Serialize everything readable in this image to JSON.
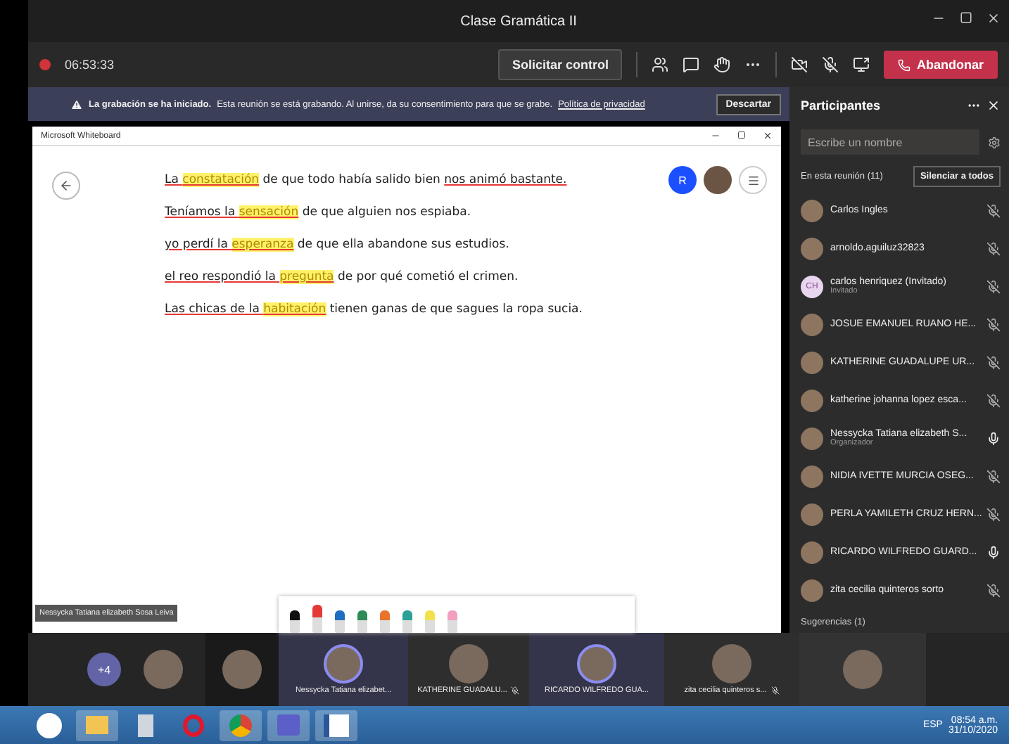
{
  "window": {
    "title": "Clase Gramática II"
  },
  "toolbar": {
    "timer": "06:53:33",
    "request_control": "Solicitar control",
    "leave": "Abandonar"
  },
  "banner": {
    "title": "La grabación se ha iniciado.",
    "text": "Esta reunión se está grabando. Al unirse, da su consentimiento para que se grabe.",
    "link": "Política de privacidad",
    "dismiss": "Descartar"
  },
  "whiteboard": {
    "title": "Microsoft Whiteboard",
    "presenter": "Nessycka Tatiana elizabeth Sosa Leiva",
    "user_initial": "R",
    "lines": [
      [
        {
          "text": "La ",
          "highlight": false,
          "underlined": true
        },
        {
          "text": "constatación",
          "highlight": true,
          "underlined": true
        },
        {
          "text": " de que todo había salido bien ",
          "highlight": false,
          "underlined": false
        },
        {
          "text": "nos animó bastante.",
          "highlight": false,
          "underlined": true
        }
      ],
      [
        {
          "text": "Teníamos la ",
          "highlight": false,
          "underlined": true
        },
        {
          "text": "sensación",
          "highlight": true,
          "underlined": true
        },
        {
          "text": " de que alguien nos espiaba.",
          "highlight": false,
          "underlined": false
        }
      ],
      [
        {
          "text": "yo perdí la ",
          "highlight": false,
          "underlined": true
        },
        {
          "text": "esperanza",
          "highlight": true,
          "underlined": true
        },
        {
          "text": " de que ella abandone sus estudios.",
          "highlight": false,
          "underlined": false
        }
      ],
      [
        {
          "text": "el reo respondió la ",
          "highlight": false,
          "underlined": true
        },
        {
          "text": "pregunta",
          "highlight": true,
          "underlined": true
        },
        {
          "text": " de por qué cometió el crimen.",
          "highlight": false,
          "underlined": false
        }
      ],
      [
        {
          "text": "Las chicas de la ",
          "highlight": false,
          "underlined": true
        },
        {
          "text": "habitación",
          "highlight": true,
          "underlined": true
        },
        {
          "text": " tienen ganas de que sagues la ropa sucia.",
          "highlight": false,
          "underlined": false
        }
      ]
    ],
    "pens": [
      {
        "color": "#111111",
        "selected": false
      },
      {
        "color": "#e53935",
        "selected": true
      },
      {
        "color": "#1e6fc0",
        "selected": false
      },
      {
        "color": "#2e8b57",
        "selected": false
      },
      {
        "color": "#e8732a",
        "selected": false
      },
      {
        "color": "#2aa198",
        "selected": false
      },
      {
        "color": "#f4e04d",
        "selected": false
      },
      {
        "color": "#f29fc0",
        "selected": false
      }
    ]
  },
  "participants": {
    "title": "Participantes",
    "search": {
      "placeholder": "Escribe un nombre"
    },
    "section": "En esta reunión (11)",
    "mute_all": "Silenciar a todos",
    "suggestions": "Sugerencias (1)",
    "people": [
      {
        "name": "Carlos Ingles",
        "muted": true
      },
      {
        "name": "arnoldo.aguiluz32823",
        "muted": true
      },
      {
        "name": "carlos henriquez (Invitado)",
        "subtitle": "Invitado",
        "initials": "CH",
        "muted": true
      },
      {
        "name": "JOSUE EMANUEL RUANO HE...",
        "muted": true
      },
      {
        "name": "KATHERINE GUADALUPE UR...",
        "muted": true
      },
      {
        "name": "katherine johanna lopez esca...",
        "muted": true
      },
      {
        "name": "Nessycka Tatiana elizabeth S...",
        "subtitle": "Organizador",
        "muted": false
      },
      {
        "name": "NIDIA IVETTE MURCIA OSEG...",
        "muted": true
      },
      {
        "name": "PERLA YAMILETH CRUZ HERN...",
        "muted": true
      },
      {
        "name": "RICARDO WILFREDO GUARD...",
        "muted": false
      },
      {
        "name": "zita cecilia quinteros sorto",
        "muted": true
      }
    ]
  },
  "video_strip": {
    "overflow": "+4",
    "tiles": [
      {
        "name": "Nessycka Tatiana elizabet...",
        "speaking": true,
        "muted": false
      },
      {
        "name": "KATHERINE GUADALU...",
        "speaking": false,
        "muted": true
      },
      {
        "name": "RICARDO WILFREDO GUA...",
        "speaking": true,
        "muted": false
      },
      {
        "name": "zita cecilia quinteros s...",
        "speaking": false,
        "muted": true
      }
    ]
  },
  "taskbar": {
    "language": "ESP",
    "time": "08:54 a.m.",
    "date": "31/10/2020"
  }
}
